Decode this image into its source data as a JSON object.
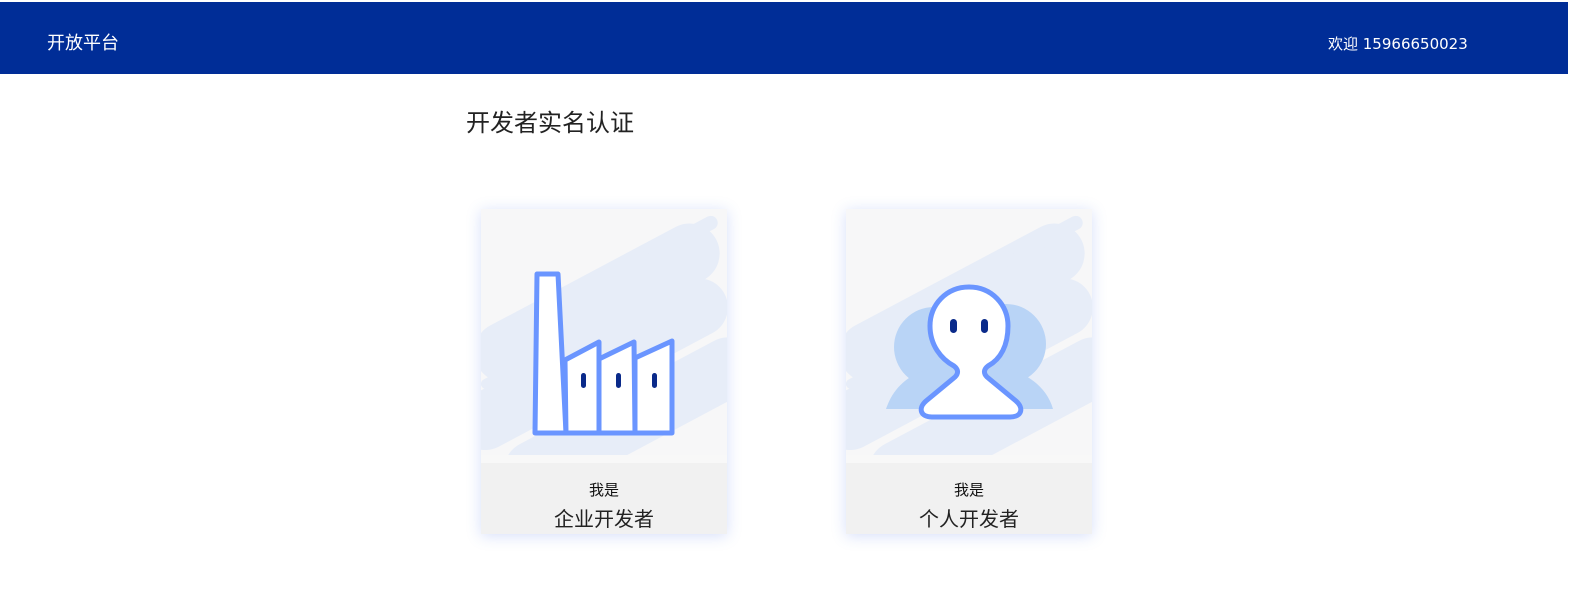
{
  "header": {
    "brand": "开放平台",
    "welcome": "欢迎 15966650023"
  },
  "page": {
    "title": "开发者实名认证"
  },
  "cards": [
    {
      "prefix": "我是",
      "label": "企业开发者",
      "icon": "factory-icon"
    },
    {
      "prefix": "我是",
      "label": "个人开发者",
      "icon": "person-icon"
    }
  ],
  "colors": {
    "header_bg": "#002d97",
    "icon_stroke": "#6a95ff",
    "icon_accent": "#0a2a8a",
    "decor_stripe": "#e6ecf8"
  }
}
